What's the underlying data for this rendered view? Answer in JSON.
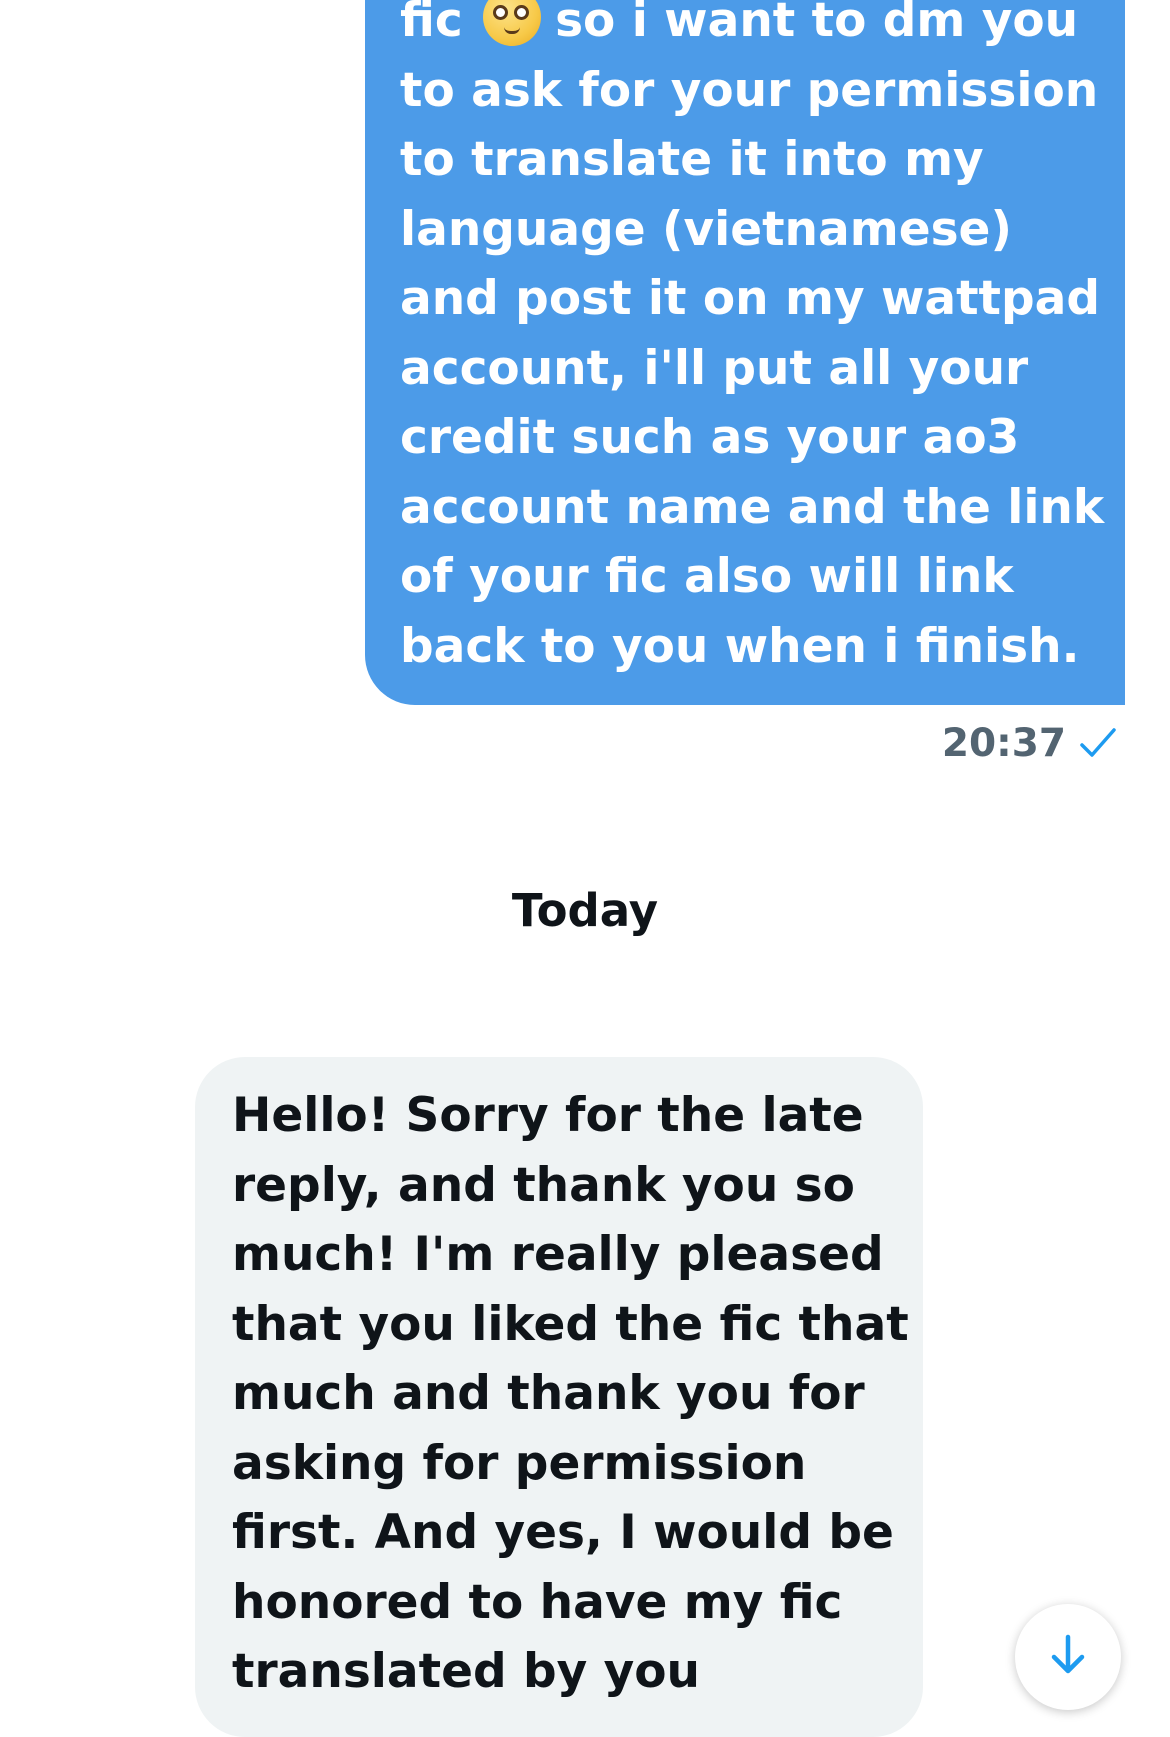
{
  "conversation": {
    "sent_message": {
      "line_1_before_emoji": "fic",
      "emoji": "pleading-face",
      "line_1_after_emoji": "so i want to dm you",
      "remaining_text": "to ask for your permission\nto translate it into my\nlanguage (vietnamese)\nand post it on my wattpad\naccount, i'll put all your\ncredit such as your ao3\naccount name and the link\nof your fic also will link\nback to you when i finish.",
      "time": "20:37",
      "status_icon": "check-icon"
    },
    "day_separator": "Today",
    "received_message": {
      "text": "Hello! Sorry for the late\nreply, and thank you so\nmuch! I'm really pleased\nthat you liked the fic that\nmuch and thank you for\nasking for permission\nfirst. And yes, I would be\nhonored to have my fic\ntranslated by you"
    }
  },
  "scroll_button": {
    "icon": "arrow-down-icon"
  },
  "colors": {
    "sent_bubble": "#4c9be8",
    "received_bubble": "#eff3f4",
    "accent": "#1d9bf0",
    "timestamp": "#536471",
    "text_dark": "#0f1419"
  }
}
